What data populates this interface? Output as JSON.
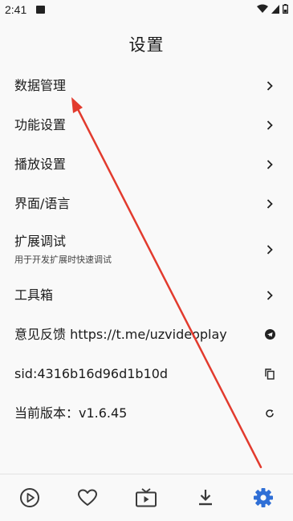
{
  "status_bar": {
    "time": "2:41"
  },
  "header": {
    "title": "设置"
  },
  "settings": {
    "data_management": "数据管理",
    "feature_settings": "功能设置",
    "playback_settings": "播放设置",
    "interface_language": "界面/语言",
    "extension_debug": "扩展调试",
    "extension_debug_sub": "用于开发扩展时快速调试",
    "toolbox": "工具箱",
    "feedback": "意见反馈 https://t.me/uzvideoplay",
    "sid": "sid:4316b16d96d1b10d",
    "version": "当前版本：v1.6.45"
  },
  "bottom_nav": {
    "items": [
      "play-icon",
      "heart-icon",
      "tv-icon",
      "download-icon",
      "gear-icon"
    ],
    "active": "gear-icon"
  },
  "colors": {
    "accent": "#2f6fd6",
    "annotation": "#e23b2e"
  }
}
